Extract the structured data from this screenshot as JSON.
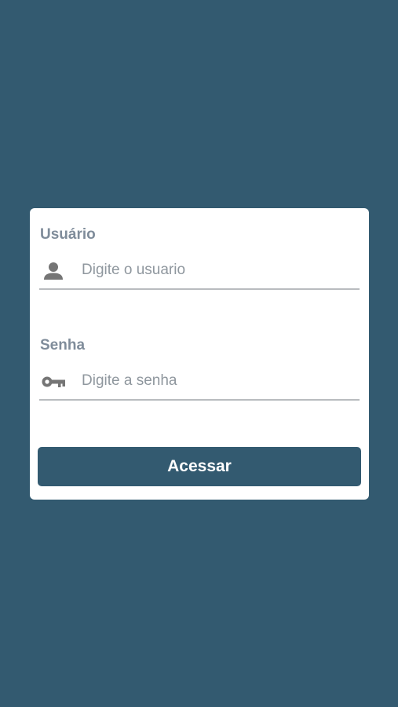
{
  "login_form": {
    "username": {
      "label": "Usuário",
      "placeholder": "Digite o usuario",
      "value": "",
      "icon": "user-icon"
    },
    "password": {
      "label": "Senha",
      "placeholder": "Digite a senha",
      "value": "",
      "icon": "key-icon"
    },
    "submit_label": "Acessar"
  },
  "colors": {
    "background": "#335a70",
    "card": "#ffffff",
    "label": "#7f8c9a",
    "placeholder": "#8f979e",
    "icon": "#757575",
    "underline": "#b9bcbf",
    "button": "#335a70",
    "button_text": "#ffffff"
  }
}
